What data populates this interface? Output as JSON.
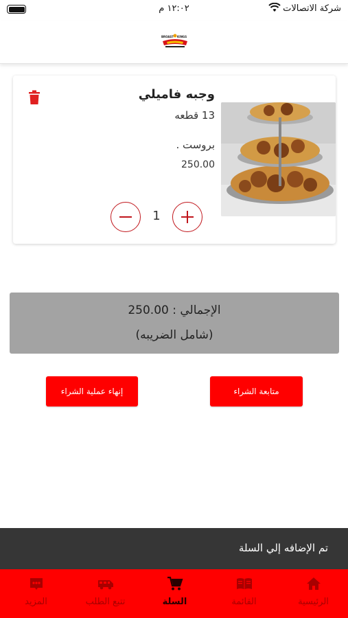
{
  "status_bar": {
    "carrier": "شركة الاتصالات",
    "time": "١٢:٠٢ م"
  },
  "header": {
    "logo_name": "BROAST KINGS logo"
  },
  "cart_item": {
    "name": "وجبه فاميلي",
    "pieces": "13 قطعه",
    "type": "بروست .",
    "price": "250.00",
    "quantity": "1"
  },
  "total": {
    "line": "الإجمالي : 250.00",
    "tax_note": "(شامل الضريبه)"
  },
  "buttons": {
    "continue_shopping": "متابعة الشراء",
    "checkout": "إنهاء عملية الشراء"
  },
  "toast": {
    "message": "تم الإضافه إلي السلة"
  },
  "bottom_nav": {
    "items": [
      {
        "label": "الرئيسية",
        "icon": "home-icon"
      },
      {
        "label": "القائمة",
        "icon": "menu-book-icon"
      },
      {
        "label": "السلة",
        "icon": "cart-icon",
        "active": true
      },
      {
        "label": "تتبع الطلب",
        "icon": "delivery-van-icon"
      },
      {
        "label": "المزيد",
        "icon": "more-icon"
      }
    ]
  },
  "colors": {
    "accent_red": "#ff0000",
    "dark_red": "#c0151b",
    "total_bg": "#a3a3a3",
    "toast_bg": "#363636"
  }
}
